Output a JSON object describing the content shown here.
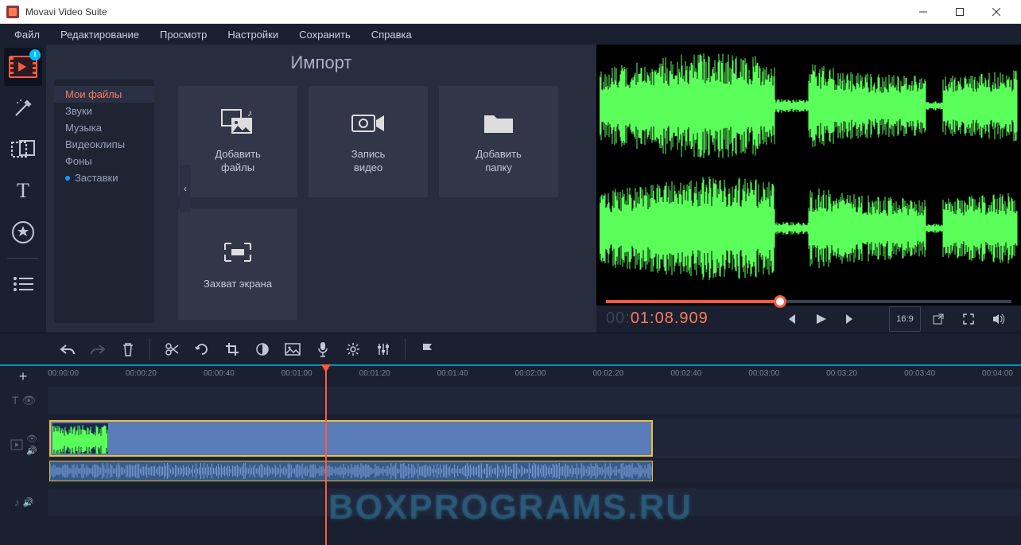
{
  "window": {
    "title": "Movavi Video Suite"
  },
  "menu": [
    "Файл",
    "Редактирование",
    "Просмотр",
    "Настройки",
    "Сохранить",
    "Справка"
  ],
  "left_tools": [
    {
      "name": "import-tool",
      "icon": "film",
      "active": true,
      "badge": "!"
    },
    {
      "name": "filters-tool",
      "icon": "wand"
    },
    {
      "name": "transitions-tool",
      "icon": "transition"
    },
    {
      "name": "titles-tool",
      "icon": "T"
    },
    {
      "name": "stickers-tool",
      "icon": "star"
    },
    {
      "name": "more-tool",
      "icon": "list",
      "sep_before": true
    }
  ],
  "import": {
    "heading": "Импорт",
    "categories": [
      {
        "label": "Мои файлы",
        "active": true
      },
      {
        "label": "Звуки"
      },
      {
        "label": "Музыка"
      },
      {
        "label": "Видеоклипы"
      },
      {
        "label": "Фоны"
      },
      {
        "label": "Заставки",
        "dot": true
      }
    ],
    "tiles": [
      {
        "name": "add-files-tile",
        "icon": "media",
        "label": "Добавить\nфайлы"
      },
      {
        "name": "record-video-tile",
        "icon": "camera",
        "label": "Запись\nвидео"
      },
      {
        "name": "add-folder-tile",
        "icon": "folder",
        "label": "Добавить\nпапку"
      },
      {
        "name": "screen-capture-tile",
        "icon": "capture",
        "label": "Захват экрана"
      }
    ]
  },
  "preview": {
    "seek_percent": 43,
    "timecode_gray": "00:",
    "timecode_orange": "01:08.909",
    "aspect_label": "16:9"
  },
  "toolbar": [
    {
      "name": "undo-button",
      "icon": "undo"
    },
    {
      "name": "redo-button",
      "icon": "redo",
      "dim": true
    },
    {
      "name": "delete-button",
      "icon": "trash"
    },
    {
      "sep": true
    },
    {
      "name": "split-button",
      "icon": "scissors"
    },
    {
      "name": "rotate-button",
      "icon": "rotate"
    },
    {
      "name": "crop-button",
      "icon": "crop"
    },
    {
      "name": "color-button",
      "icon": "contrast"
    },
    {
      "name": "image-button",
      "icon": "image"
    },
    {
      "name": "record-audio-button",
      "icon": "mic"
    },
    {
      "name": "clip-props-button",
      "icon": "gear"
    },
    {
      "name": "equalizer-button",
      "icon": "sliders"
    },
    {
      "sep": true
    },
    {
      "name": "marker-button",
      "icon": "flag"
    }
  ],
  "timeline": {
    "ruler_ticks": [
      "00:00:00",
      "00:00:20",
      "00:00:40",
      "00:01:00",
      "00:01:20",
      "00:01:40",
      "00:02:00",
      "00:02:20",
      "00:02:40",
      "00:03:00",
      "00:03:20",
      "00:03:40",
      "00:04:00"
    ],
    "playhead_percent": 28.5,
    "clip_end_percent": 62,
    "audio_end_percent": 62
  },
  "watermark": "BOXPROGRAMS.RU"
}
